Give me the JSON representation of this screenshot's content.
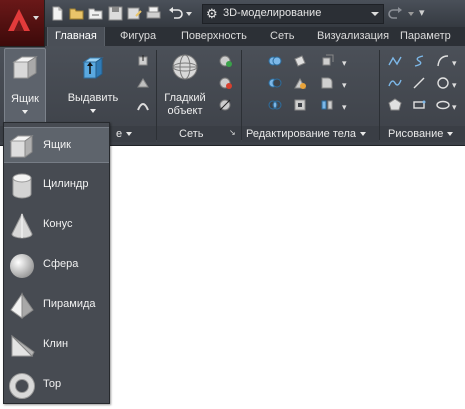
{
  "workspace": {
    "name": "3D-моделирование"
  },
  "tabs": [
    {
      "label": "Главная",
      "active": true
    },
    {
      "label": "Фигура"
    },
    {
      "label": "Поверхность"
    },
    {
      "label": "Сеть"
    },
    {
      "label": "Визуализация"
    },
    {
      "label": "Параметр"
    }
  ],
  "ribbon": {
    "box_button": {
      "label": "Ящик"
    },
    "extrude_button": {
      "label": "Выдавить"
    },
    "smooth_object_button": {
      "label_line1": "Гладкий",
      "label_line2": "объект"
    },
    "panels": {
      "modeling_tail": "е",
      "mesh": "Сеть",
      "solid_editing": "Редактирование тела",
      "draw": "Рисование"
    }
  },
  "dropdown": {
    "items": [
      {
        "label": "Ящик",
        "icon": "box-icon",
        "highlighted": true
      },
      {
        "label": "Цилиндр",
        "icon": "cylinder-icon"
      },
      {
        "label": "Конус",
        "icon": "cone-icon"
      },
      {
        "label": "Сфера",
        "icon": "sphere-icon"
      },
      {
        "label": "Пирамида",
        "icon": "pyramid-icon"
      },
      {
        "label": "Клин",
        "icon": "wedge-icon"
      },
      {
        "label": "Тор",
        "icon": "torus-icon"
      }
    ]
  },
  "colors": {
    "app_button": "#6a1818",
    "ribbon": "#464a51",
    "highlight": "#5e646c"
  }
}
